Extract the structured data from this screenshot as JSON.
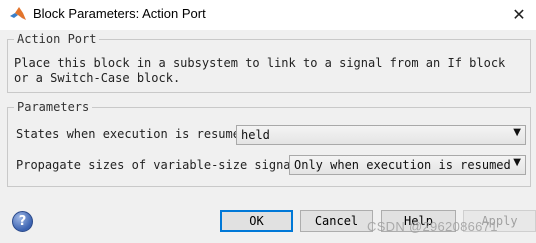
{
  "window": {
    "title": "Block Parameters: Action Port",
    "close_glyph": "✕",
    "icon": "matlab-logo-icon"
  },
  "action_port": {
    "legend": "Action Port",
    "description": "Place this block in a subsystem to link to a signal from an If block or a Switch-Case block."
  },
  "parameters": {
    "legend": "Parameters",
    "states_label": "States when execution is resumed:",
    "states_value": "held",
    "propagate_label": "Propagate sizes of variable-size signals:",
    "propagate_value": "Only when execution is resumed",
    "dropdown_glyph": "▼"
  },
  "buttons": {
    "help_glyph": "?",
    "ok": "OK",
    "cancel": "Cancel",
    "help": "Help",
    "apply": "Apply"
  },
  "watermark": "CSDN @2962086671",
  "colors": {
    "accent": "#0078d7",
    "dialog_bg": "#f0f0f0"
  }
}
